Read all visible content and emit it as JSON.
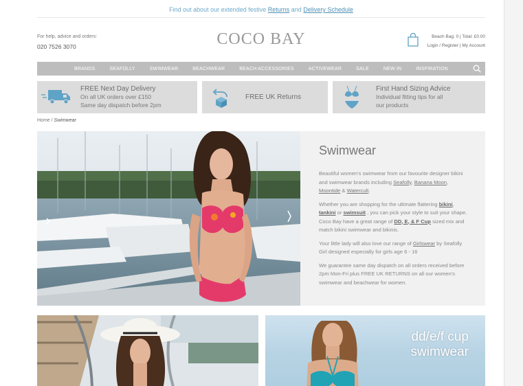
{
  "announcement": {
    "prefix": "Find out about our extended festive",
    "returns_link": "Returns",
    "and": "and",
    "delivery_link": "Delivery Schedule"
  },
  "header": {
    "help_label": "For help, advice and orders:",
    "phone": "020 7526 3070",
    "logo": "COCO BAY",
    "bag_summary": "Beach Bag: 0 | Total: £0.00",
    "account_links": "Login / Register | My Account"
  },
  "nav": {
    "items": [
      "BRANDS",
      "SEAFOLLY",
      "SWIMWEAR",
      "BEACHWEAR",
      "BEACH ACCESSORIES",
      "ACTIVEWEAR",
      "SALE",
      "NEW IN",
      "INSPIRATION"
    ]
  },
  "promos": {
    "delivery": {
      "title": "FREE Next Day Delivery",
      "line1": "On all UK orders over £150",
      "line2": "Same day dispatch before 2pm"
    },
    "returns": {
      "title": "FREE UK Returns"
    },
    "sizing": {
      "title": "First Hand Sizing Advice",
      "line1": "Individual fitting tips for all",
      "line2": "our products"
    }
  },
  "breadcrumb": {
    "home": "Home",
    "sep": "/",
    "current": "Swimwear"
  },
  "content": {
    "title": "Swimwear",
    "p1_text": "Beautiful women's swimwear from our favourite designer bikini and swimwear brands including",
    "p1_link1": "Seafolly",
    "p1_comma": ",",
    "p1_link2": "Banana Moon",
    "p1_comma2": ",",
    "p1_link3": "Moontide",
    "p1_amp": "&",
    "p1_link4": "Watercult",
    "p1_end": ".",
    "p2_text": "Whether you are shopping for the ultimate flattering",
    "p2_link1": "bikini",
    "p2_comma": ",",
    "p2_link2": "tankini",
    "p2_or": "or",
    "p2_link3": "swimsuit",
    "p2_text2": ", you can pick your style to suit your shape. Coco Bay have a great range of",
    "p2_link4": "DD, E, & F Cup",
    "p2_text3": "sized mix and match bikini swimwear and bikinis.",
    "p3_text": "Your little lady will also love our range of",
    "p3_link": "Girlswear",
    "p3_text2": "by Seafolly Girl designed especially for girls age 6 - 16",
    "p4_text": "We guarantee same day dispatch on all orders received before 2pm Mon-Fri plus FREE UK RETURNS on all our women's swimwear and beachwear for women."
  },
  "tiles": {
    "cup_line1": "dd/e/f cup",
    "cup_line2": "swimwear"
  },
  "colors": {
    "accent_blue": "#6aa9c8",
    "nav_grey": "#bdbdbd",
    "promo_grey": "#dcdcdc",
    "panel_grey": "#f1f1f1"
  }
}
